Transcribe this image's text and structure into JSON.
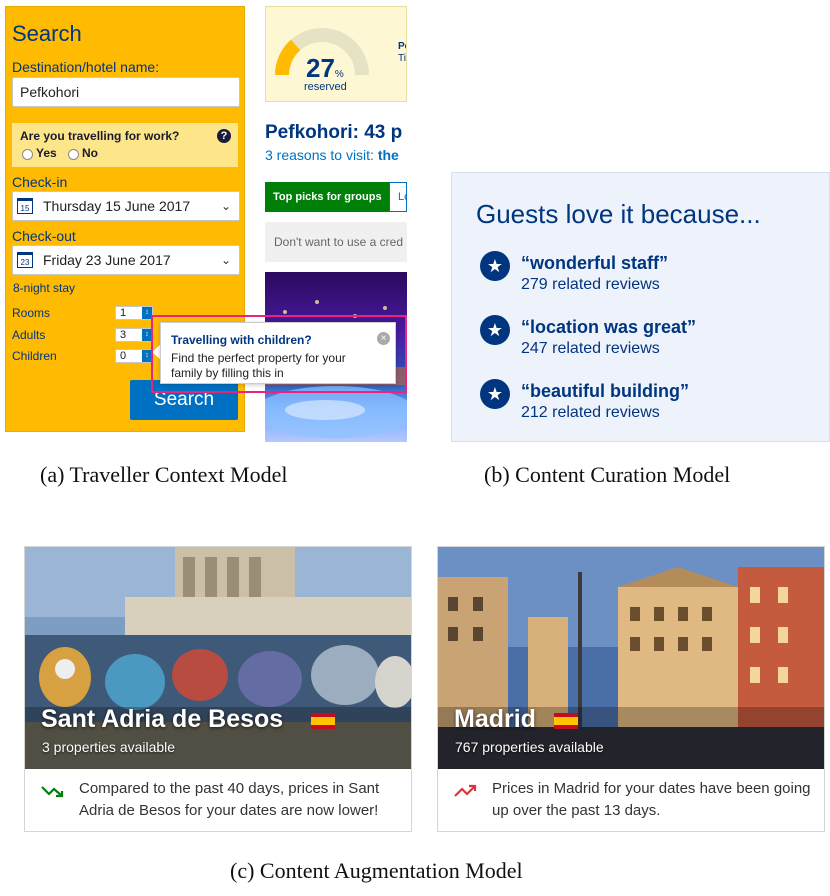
{
  "figure": {
    "captions": {
      "a": "(a)  Traveller Context Model",
      "b": "(b)  Content Curation Model",
      "c": "(c)  Content Augmentation Model"
    }
  },
  "panel_a": {
    "search": {
      "title": "Search",
      "destination_label": "Destination/hotel name:",
      "destination_value": "Pefkohori",
      "work_question": "Are you travelling for work?",
      "work_help": "?",
      "option_yes": "Yes",
      "option_no": "No",
      "checkin_label": "Check-in",
      "checkin_day": "15",
      "checkin_value": "Thursday 15 June 2017",
      "checkout_label": "Check-out",
      "checkout_day": "23",
      "checkout_value": "Friday 23 June 2017",
      "stay_length": "8-night stay",
      "rooms_label": "Rooms",
      "rooms_value": "1",
      "adults_label": "Adults",
      "adults_value": "3",
      "children_label": "Children",
      "children_value": "0",
      "search_button": "Search"
    },
    "tooltip": {
      "title": "Travelling with children?",
      "body": "Find the perfect property for your family by filling this in",
      "close": "×"
    },
    "reserved": {
      "percent": "27",
      "percent_sign": "%",
      "label": "reserved",
      "side_text_1": "Pe",
      "side_text_2": "Ti",
      "gauge_fraction": 0.27
    },
    "property": {
      "headline": "Pefkohori: 43 p",
      "reasons_prefix": "3 reasons to visit: ",
      "reasons_bold": "the",
      "tab_active": "Top picks for groups",
      "tab_next": "Lo",
      "credit_notice": "Don't want to use a cred"
    }
  },
  "panel_b": {
    "title": "Guests love it because...",
    "reasons": [
      {
        "quote": "“wonderful staff”",
        "count": "279 related reviews"
      },
      {
        "quote": "“location was great”",
        "count": "247 related reviews"
      },
      {
        "quote": "“beautiful building”",
        "count": "212 related reviews"
      }
    ]
  },
  "panel_c": {
    "cards": [
      {
        "name": "Sant Adria de Besos",
        "count": "3 properties available",
        "trend": "down",
        "trend_color": "#008009",
        "message": "Compared to the past 40 days, prices in Sant Adria de Besos for your dates are now lower!"
      },
      {
        "name": "Madrid",
        "count": "767 properties available",
        "trend": "up",
        "trend_color": "#e0343a",
        "message": "Prices in Madrid for your dates have been going up over the past 13 days."
      }
    ]
  }
}
